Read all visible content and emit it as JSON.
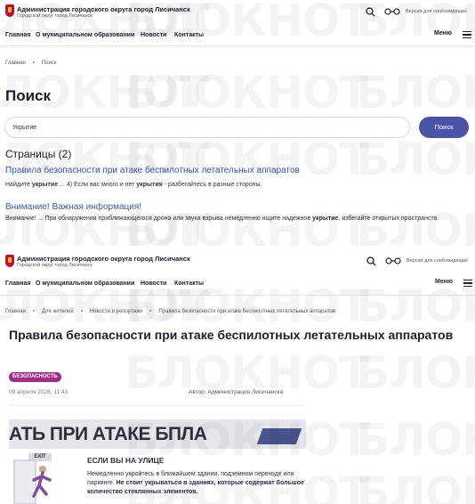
{
  "watermark": "БЛОКНОТ",
  "header": {
    "title": "Администрация городского округа город Лисичанск",
    "subtitle": "Городской округ город Лисичанск",
    "vision_label": "Версия для слабовидящих",
    "menu_label": "Меню",
    "nav": [
      "Главная",
      "О муниципальном образовании",
      "Новости",
      "Контакты"
    ]
  },
  "search_page": {
    "breadcrumb": [
      "Главная",
      "Поиск"
    ],
    "title": "Поиск",
    "query": "Укрытие",
    "button": "Поиск",
    "pages_count": "Страницы (2)",
    "results": [
      {
        "title": "Правила безопасности при атаке беспилотных летательных аппаратов",
        "snippet_parts": [
          "Найдите ",
          "укрытие",
          " ... 4) Если вас много и нет ",
          "укрытия",
          " - разбегайтесь в разные стороны."
        ]
      },
      {
        "title": "Внимание! Важная информация!",
        "snippet_parts": [
          "Внимание! ... При обнаружении приближающегося дрона или звука взрыва немедленно ищите надежное ",
          "укрытие",
          ", избегайте открытых пространств."
        ]
      }
    ]
  },
  "article_page": {
    "breadcrumb": [
      "Главная",
      "Для жителей",
      "Новости и репортажи",
      "Правила безопасности при атаке беспилотных летательных аппаратов"
    ],
    "title": "Правила безопасности при атаке беспилотных летательных аппаратов",
    "tag": "БЕЗОПАСНОСТЬ",
    "date": "09 апреля 2026, 11:43",
    "author": "Автор: Администрация Лисичанска",
    "poster": {
      "heading": "АТЬ ПРИ АТАКЕ БПЛА",
      "exit_sign": "EXIT",
      "subheading": "ЕСЛИ ВЫ НА УЛИЦЕ",
      "text_parts": [
        "Немедленно укройтесь в ближайшем здании, подземном переходе или паркинге. ",
        "Не стоит укрываться в зданиях, которые содержат большое количество стеклянных элементов."
      ]
    }
  },
  "colors": {
    "accent": "#4a53a8",
    "link": "#3a56b5",
    "tag": "#a52a8c",
    "logo": "#c8102e"
  }
}
